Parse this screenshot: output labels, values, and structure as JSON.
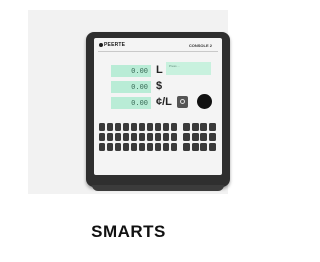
{
  "product": {
    "title": "SMARTS",
    "console": {
      "brand": "PEERTE",
      "model_label": "CONSOLE 2",
      "displays": [
        {
          "value": "0.00",
          "unit": "L"
        },
        {
          "value": "0.00",
          "unit": "$"
        },
        {
          "value": "0.00",
          "unit": "¢/L"
        }
      ],
      "info_text": "Press ..."
    }
  },
  "colors": {
    "console_body": "#2f2f2f",
    "lcd_green": "#b9ecd6",
    "background": "#f2f2f2"
  }
}
